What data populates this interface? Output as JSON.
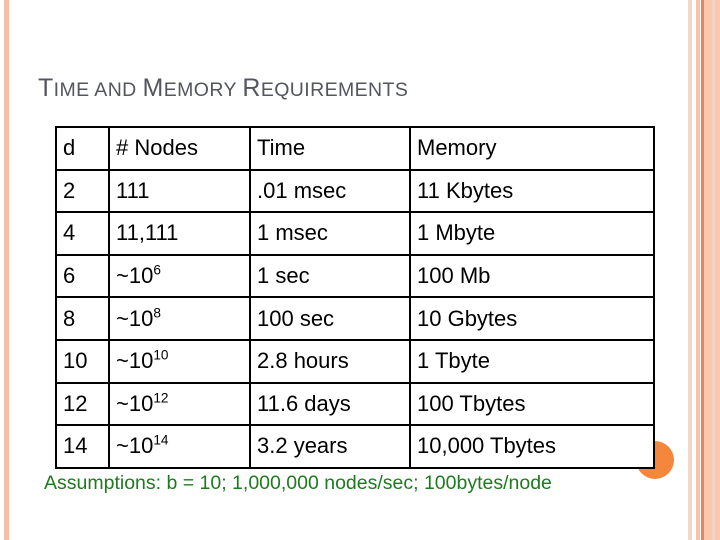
{
  "slide": {
    "title_parts": [
      {
        "text": "T",
        "style": "cap"
      },
      {
        "text": "IME ",
        "style": "sc"
      },
      {
        "text": "AND ",
        "style": "sc"
      },
      {
        "text": "M",
        "style": "cap"
      },
      {
        "text": "EMORY ",
        "style": "sc"
      },
      {
        "text": "R",
        "style": "cap"
      },
      {
        "text": "EQUIREMENTS",
        "style": "sc"
      }
    ],
    "title_text": "TIME AND MEMORY REQUIREMENTS",
    "assumptions": "Assumptions: b = 10; 1,000,000 nodes/sec; 100bytes/node"
  },
  "colors": {
    "title": "#53565E",
    "depth_column": "#C8873C",
    "highlight_red": "#CC2222",
    "assumptions_green": "#1E7A1E",
    "accent_orange": "#F4873C",
    "stripe_salmon": "#F7BFA8",
    "table_border": "#000000"
  },
  "table": {
    "name": "time-and-memory-requirements",
    "headers": [
      "d",
      "# Nodes",
      "Time",
      "Memory"
    ],
    "rows": [
      {
        "d": "2",
        "nodes_base": "111",
        "nodes_exp": "",
        "time": ".01 msec",
        "memory": "11 Kbytes",
        "highlight": false
      },
      {
        "d": "4",
        "nodes_base": "11,111",
        "nodes_exp": "",
        "time": "1 msec",
        "memory": "1 Mbyte",
        "highlight": false
      },
      {
        "d": "6",
        "nodes_base": "~10",
        "nodes_exp": "6",
        "time": "1 sec",
        "memory": "100 Mb",
        "highlight": false
      },
      {
        "d": "8",
        "nodes_base": "~10",
        "nodes_exp": "8",
        "time": "100 sec",
        "memory": "10 Gbytes",
        "highlight": false
      },
      {
        "d": "10",
        "nodes_base": "~10",
        "nodes_exp": "10",
        "time": "2.8 hours",
        "memory": "1 Tbyte",
        "highlight": true
      },
      {
        "d": "12",
        "nodes_base": "~10",
        "nodes_exp": "12",
        "time": "11.6 days",
        "memory": "100 Tbytes",
        "highlight": false
      },
      {
        "d": "14",
        "nodes_base": "~10",
        "nodes_exp": "14",
        "time": "3.2 years",
        "memory": "10,000 Tbytes",
        "highlight": false
      }
    ]
  }
}
